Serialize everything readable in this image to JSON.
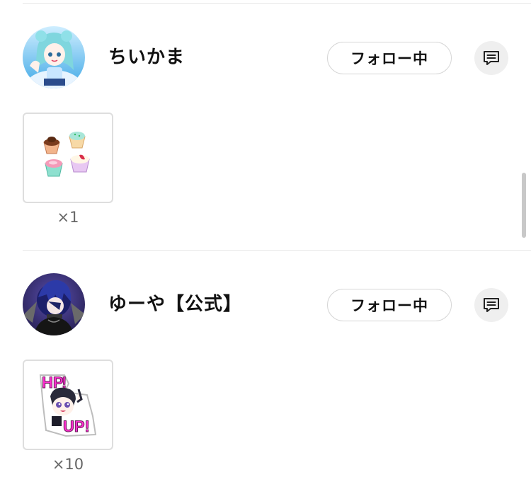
{
  "entries": [
    {
      "username": "ちいかま",
      "follow_label": "フォロー中",
      "avatar_icon": "anime-girl-avatar",
      "message_icon": "message-icon",
      "gift": {
        "icon": "pudding-cups-gift-icon",
        "count": "×1"
      }
    },
    {
      "username": "ゆーや【公式】",
      "follow_label": "フォロー中",
      "avatar_icon": "anime-boy-avatar",
      "message_icon": "message-icon",
      "gift": {
        "icon": "hp-up-sticker-gift-icon",
        "count": "×10"
      }
    }
  ],
  "colors": {
    "divider": "#e6e6e6",
    "button_border": "#d6d6d6",
    "message_bg": "#efefef",
    "count_text": "#666666",
    "sticker_pink": "#ff2fd0"
  }
}
